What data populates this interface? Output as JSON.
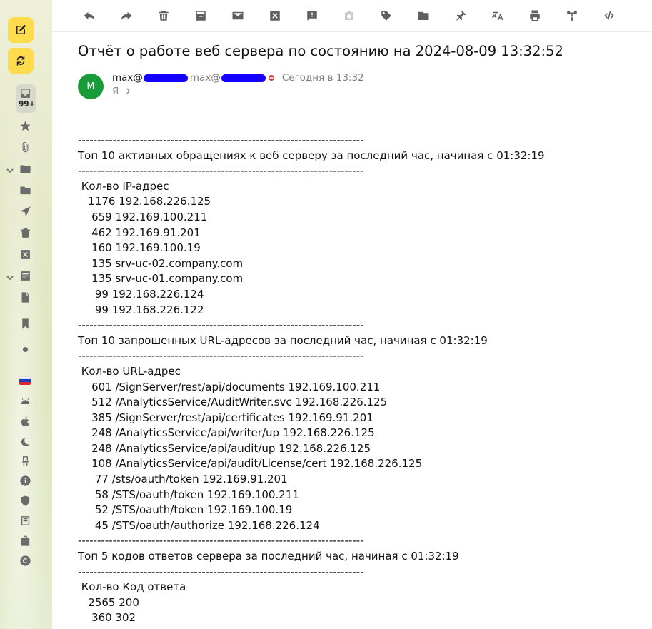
{
  "sidebar": {
    "compose_icon": "compose-icon",
    "refresh_icon": "refresh-icon",
    "inbox_badge": "99+",
    "flag_colors": [
      "#ffffff",
      "#1c3fbf",
      "#e0262b"
    ]
  },
  "toolbar": {
    "icons": [
      "reply-icon",
      "forward-icon",
      "delete-icon",
      "archive-icon",
      "mark-read-icon",
      "spam-icon",
      "reminder-icon",
      "snooze-icon",
      "label-icon",
      "folder-icon",
      "pin-icon",
      "translate-icon",
      "print-icon",
      "tree-icon",
      "source-code-icon"
    ]
  },
  "message": {
    "subject": "Отчёт о работе веб сервера по состоянию на 2024-08-09 13:32:52",
    "avatar_letter": "M",
    "avatar_color": "#1a9b3a",
    "from_prefix": "max@",
    "sender_email_prefix": "max@",
    "date": "Сегодня в 13:32",
    "to": "Я"
  },
  "body_lines": [
    "--------------------------------------------------------------------------",
    "Топ 10 активных обращениях к веб серверу за последний час, начиная с 01:32:19",
    "--------------------------------------------------------------------------",
    " Кол-во IP-адрес",
    "   1176 192.168.226.125",
    "    659 192.169.100.211",
    "    462 192.169.91.201",
    "    160 192.169.100.19",
    "    135 srv-uc-02.company.com",
    "    135 srv-uc-01.company.com",
    "     99 192.168.226.124",
    "     99 192.168.226.122",
    "--------------------------------------------------------------------------",
    "Топ 10 запрошенных URL-адресов за последний час, начиная с 01:32:19",
    "--------------------------------------------------------------------------",
    " Кол-во URL-адрес",
    "    601 /SignServer/rest/api/documents 192.169.100.211",
    "    512 /AnalyticsService/AuditWriter.svc 192.168.226.125",
    "    385 /SignServer/rest/api/certificates 192.169.91.201",
    "    248 /AnalyticsService/api/writer/up 192.168.226.125",
    "    248 /AnalyticsService/api/audit/up 192.168.226.125",
    "    108 /AnalyticsService/api/audit/License/cert 192.168.226.125",
    "     77 /sts/oauth/token 192.169.91.201",
    "     58 /STS/oauth/token 192.169.100.211",
    "     52 /STS/oauth/token 192.169.100.19",
    "     45 /STS/oauth/authorize 192.168.226.124",
    "--------------------------------------------------------------------------",
    "Топ 5 кодов ответов сервера за последний час, начиная с 01:32:19",
    "--------------------------------------------------------------------------",
    " Кол-во Код ответа",
    "   2565 200",
    "    360 302"
  ]
}
